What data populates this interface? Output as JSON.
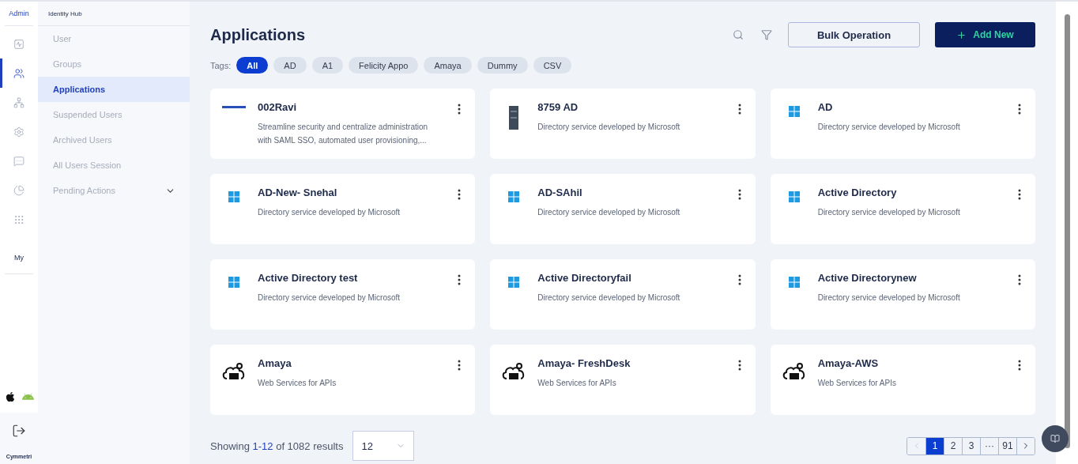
{
  "rail": {
    "title": "Admin",
    "items": [
      {
        "kind": "chart",
        "selected": false
      },
      {
        "kind": "users",
        "selected": true
      },
      {
        "kind": "network",
        "selected": false
      },
      {
        "kind": "settings",
        "selected": false
      },
      {
        "kind": "chat",
        "selected": false
      },
      {
        "kind": "pie",
        "selected": false
      },
      {
        "kind": "grid",
        "selected": false
      }
    ],
    "my_label": "My",
    "brand": "Cymmetri"
  },
  "subnav": {
    "title": "Identity Hub",
    "items": [
      {
        "label": "User",
        "selected": false
      },
      {
        "label": "Groups",
        "selected": false
      },
      {
        "label": "Applications",
        "selected": true
      },
      {
        "label": "Suspended Users",
        "selected": false
      },
      {
        "label": "Archived Users",
        "selected": false
      },
      {
        "label": "All Users Session",
        "selected": false
      },
      {
        "label": "Pending Actions",
        "selected": false,
        "expandable": true
      }
    ]
  },
  "header": {
    "title": "Applications",
    "bulk_button": "Bulk Operation",
    "add_button": "Add New"
  },
  "tags": {
    "label": "Tags:",
    "items": [
      {
        "label": "All",
        "selected": true
      },
      {
        "label": "AD",
        "selected": false
      },
      {
        "label": "A1",
        "selected": false
      },
      {
        "label": "Felicity Appo",
        "selected": false
      },
      {
        "label": "Amaya",
        "selected": false
      },
      {
        "label": "Dummy",
        "selected": false
      },
      {
        "label": "CSV",
        "selected": false
      }
    ]
  },
  "apps": [
    {
      "name": "002Ravi",
      "kind": "wordmark",
      "description": "Streamline security and centralize administration with SAML SSO, automated user provisioning,..."
    },
    {
      "name": "8759 AD",
      "kind": "image",
      "description": "Directory service developed by Microsoft"
    },
    {
      "name": "AD",
      "kind": "windows",
      "description": "Directory service developed by Microsoft"
    },
    {
      "name": "AD-New- Snehal",
      "kind": "windows",
      "description": "Directory service developed by Microsoft"
    },
    {
      "name": "AD-SAhil",
      "kind": "windows",
      "description": "Directory service developed by Microsoft"
    },
    {
      "name": "Active Directory",
      "kind": "windows",
      "description": "Directory service developed by Microsoft"
    },
    {
      "name": "Active Directory test",
      "kind": "windows",
      "description": "Directory service developed by Microsoft"
    },
    {
      "name": "Active Directoryfail",
      "kind": "windows",
      "description": "Directory service developed by Microsoft"
    },
    {
      "name": "Active Directorynew",
      "kind": "windows",
      "description": "Directory service developed by Microsoft"
    },
    {
      "name": "Amaya",
      "kind": "rest",
      "description": "Web Services for APIs"
    },
    {
      "name": "Amaya- FreshDesk",
      "kind": "rest",
      "description": "Web Services for APIs"
    },
    {
      "name": "Amaya-AWS",
      "kind": "rest",
      "description": "Web Services for APIs"
    }
  ],
  "footer": {
    "showing": "Showing",
    "range": "1-12",
    "of_total": "of 1082 results",
    "page_size": "12",
    "pages": [
      {
        "label": "1",
        "selected": true
      },
      {
        "label": "2",
        "selected": false
      },
      {
        "label": "3",
        "selected": false
      },
      {
        "label": "···",
        "selected": false
      },
      {
        "label": "91",
        "selected": false
      }
    ],
    "prev_disabled": true
  }
}
